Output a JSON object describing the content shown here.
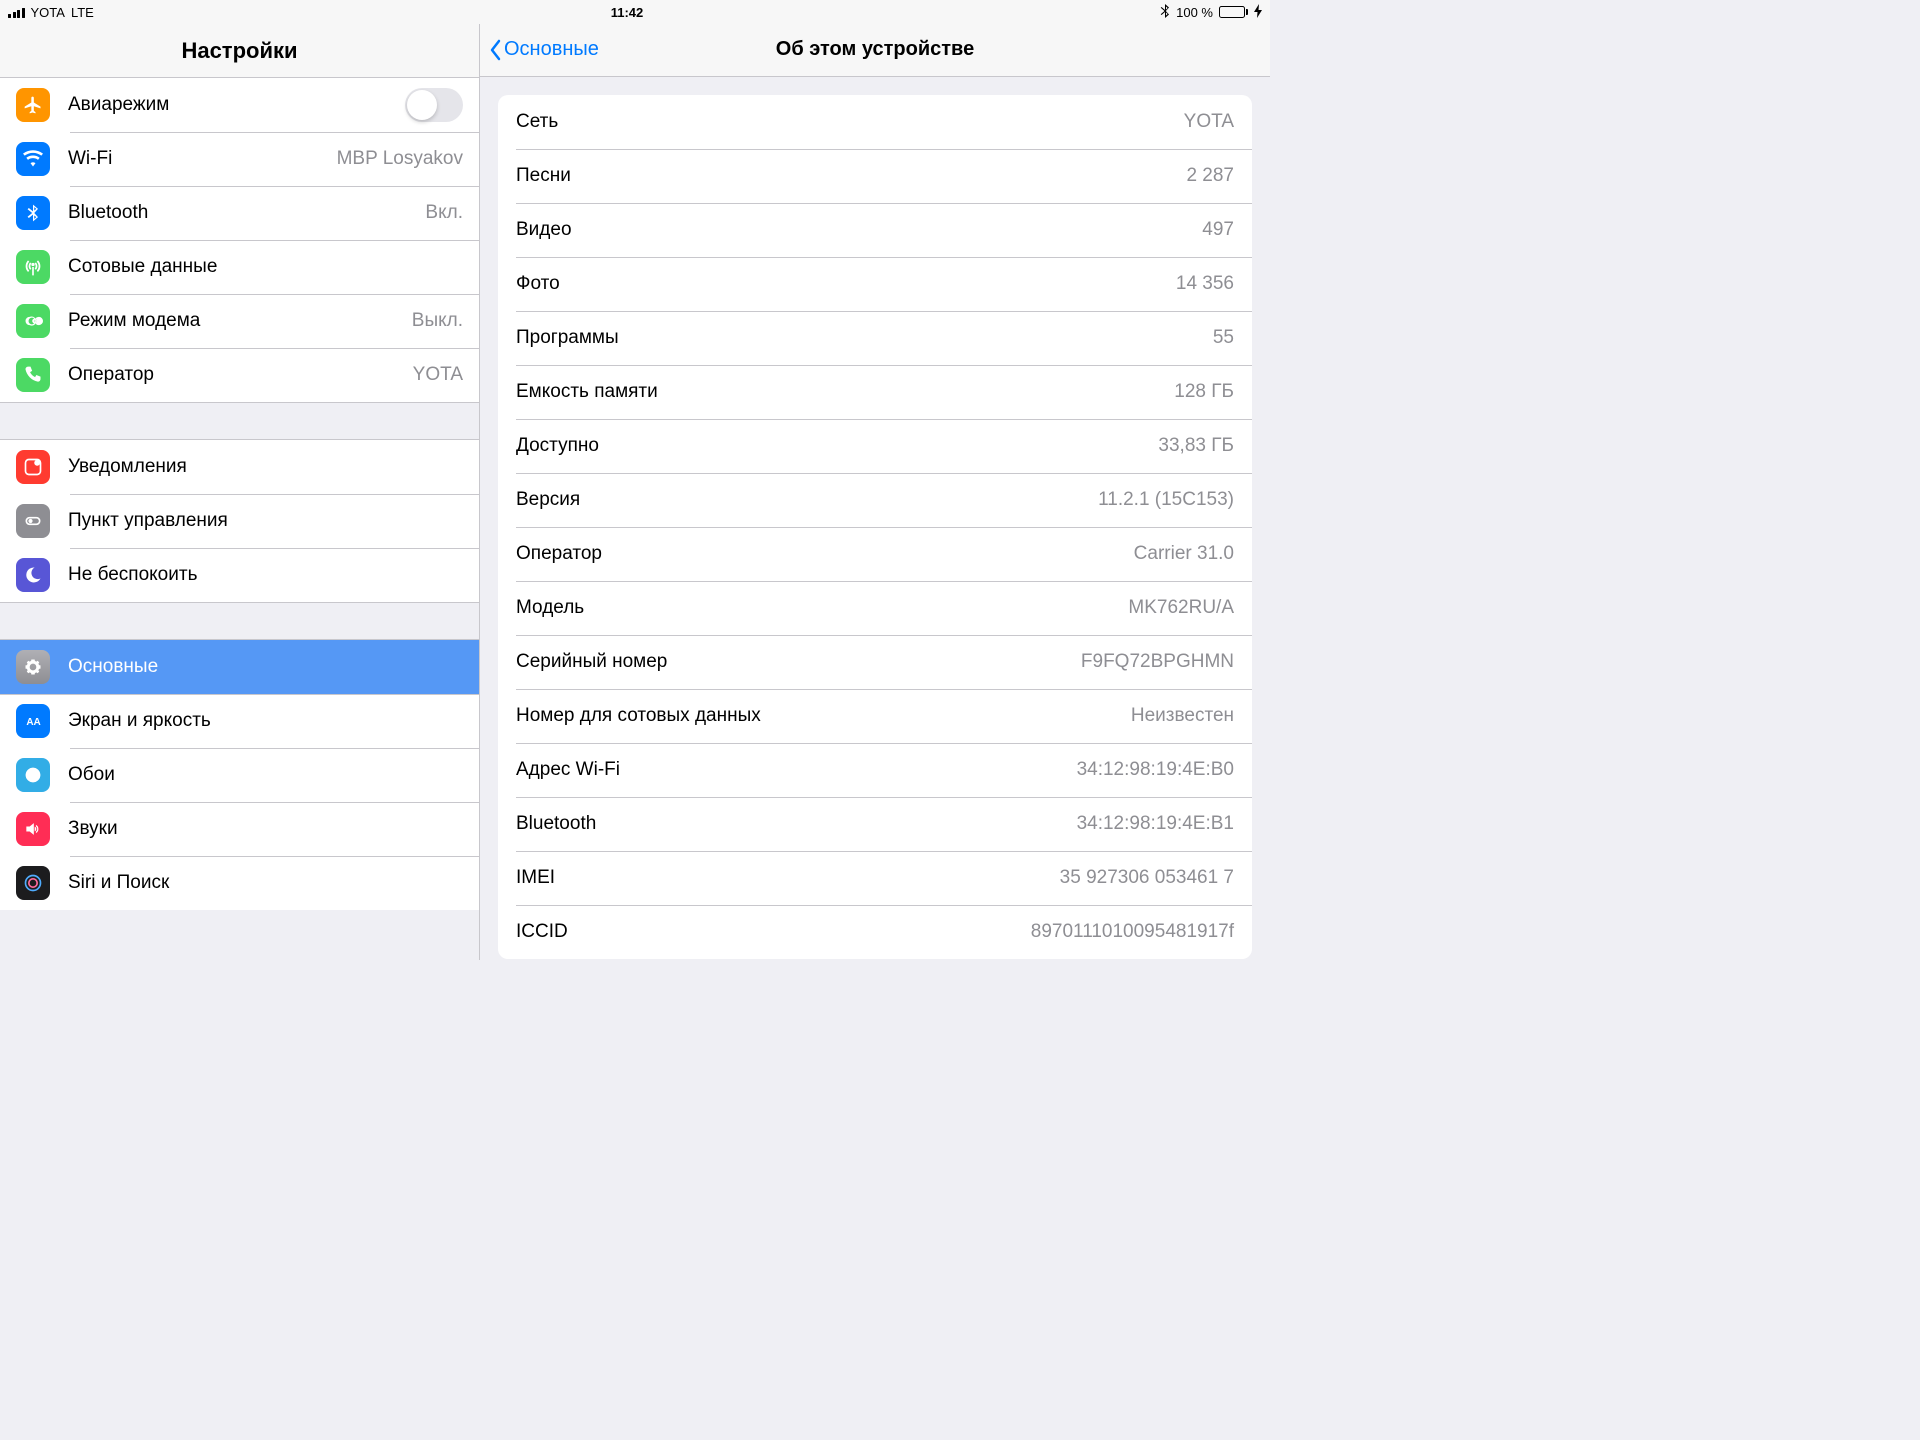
{
  "status": {
    "carrier": "YOTA",
    "net": "LTE",
    "time": "11:42",
    "battery_pct": "100 %"
  },
  "left": {
    "title": "Настройки",
    "g1": [
      {
        "label": "Авиарежим",
        "kind": "toggle"
      },
      {
        "label": "Wi-Fi",
        "value": "MBP Losyakov"
      },
      {
        "label": "Bluetooth",
        "value": "Вкл."
      },
      {
        "label": "Сотовые данные"
      },
      {
        "label": "Режим модема",
        "value": "Выкл."
      },
      {
        "label": "Оператор",
        "value": "YOTA"
      }
    ],
    "g2": [
      {
        "label": "Уведомления"
      },
      {
        "label": "Пункт управления"
      },
      {
        "label": "Не беспокоить"
      }
    ],
    "g3": [
      {
        "label": "Основные",
        "selected": true
      },
      {
        "label": "Экран и яркость"
      },
      {
        "label": "Обои"
      },
      {
        "label": "Звуки"
      },
      {
        "label": "Siri и Поиск"
      }
    ]
  },
  "right": {
    "back": "Основные",
    "title": "Об этом устройстве",
    "rows": [
      {
        "label": "Сеть",
        "value": "YOTA"
      },
      {
        "label": "Песни",
        "value": "2 287"
      },
      {
        "label": "Видео",
        "value": "497"
      },
      {
        "label": "Фото",
        "value": "14 356"
      },
      {
        "label": "Программы",
        "value": "55"
      },
      {
        "label": "Емкость памяти",
        "value": "128 ГБ"
      },
      {
        "label": "Доступно",
        "value": "33,83 ГБ"
      },
      {
        "label": "Версия",
        "value": "11.2.1 (15C153)"
      },
      {
        "label": "Оператор",
        "value": "Carrier 31.0"
      },
      {
        "label": "Модель",
        "value": "MK762RU/A"
      },
      {
        "label": "Серийный номер",
        "value": "F9FQ72BPGHMN"
      },
      {
        "label": "Номер для сотовых данных",
        "value": "Неизвестен"
      },
      {
        "label": "Адрес Wi-Fi",
        "value": "34:12:98:19:4E:B0"
      },
      {
        "label": "Bluetooth",
        "value": "34:12:98:19:4E:B1"
      },
      {
        "label": "IMEI",
        "value": "35 927306 053461 7"
      },
      {
        "label": "ICCID",
        "value": "8970111010095481917f"
      }
    ]
  }
}
